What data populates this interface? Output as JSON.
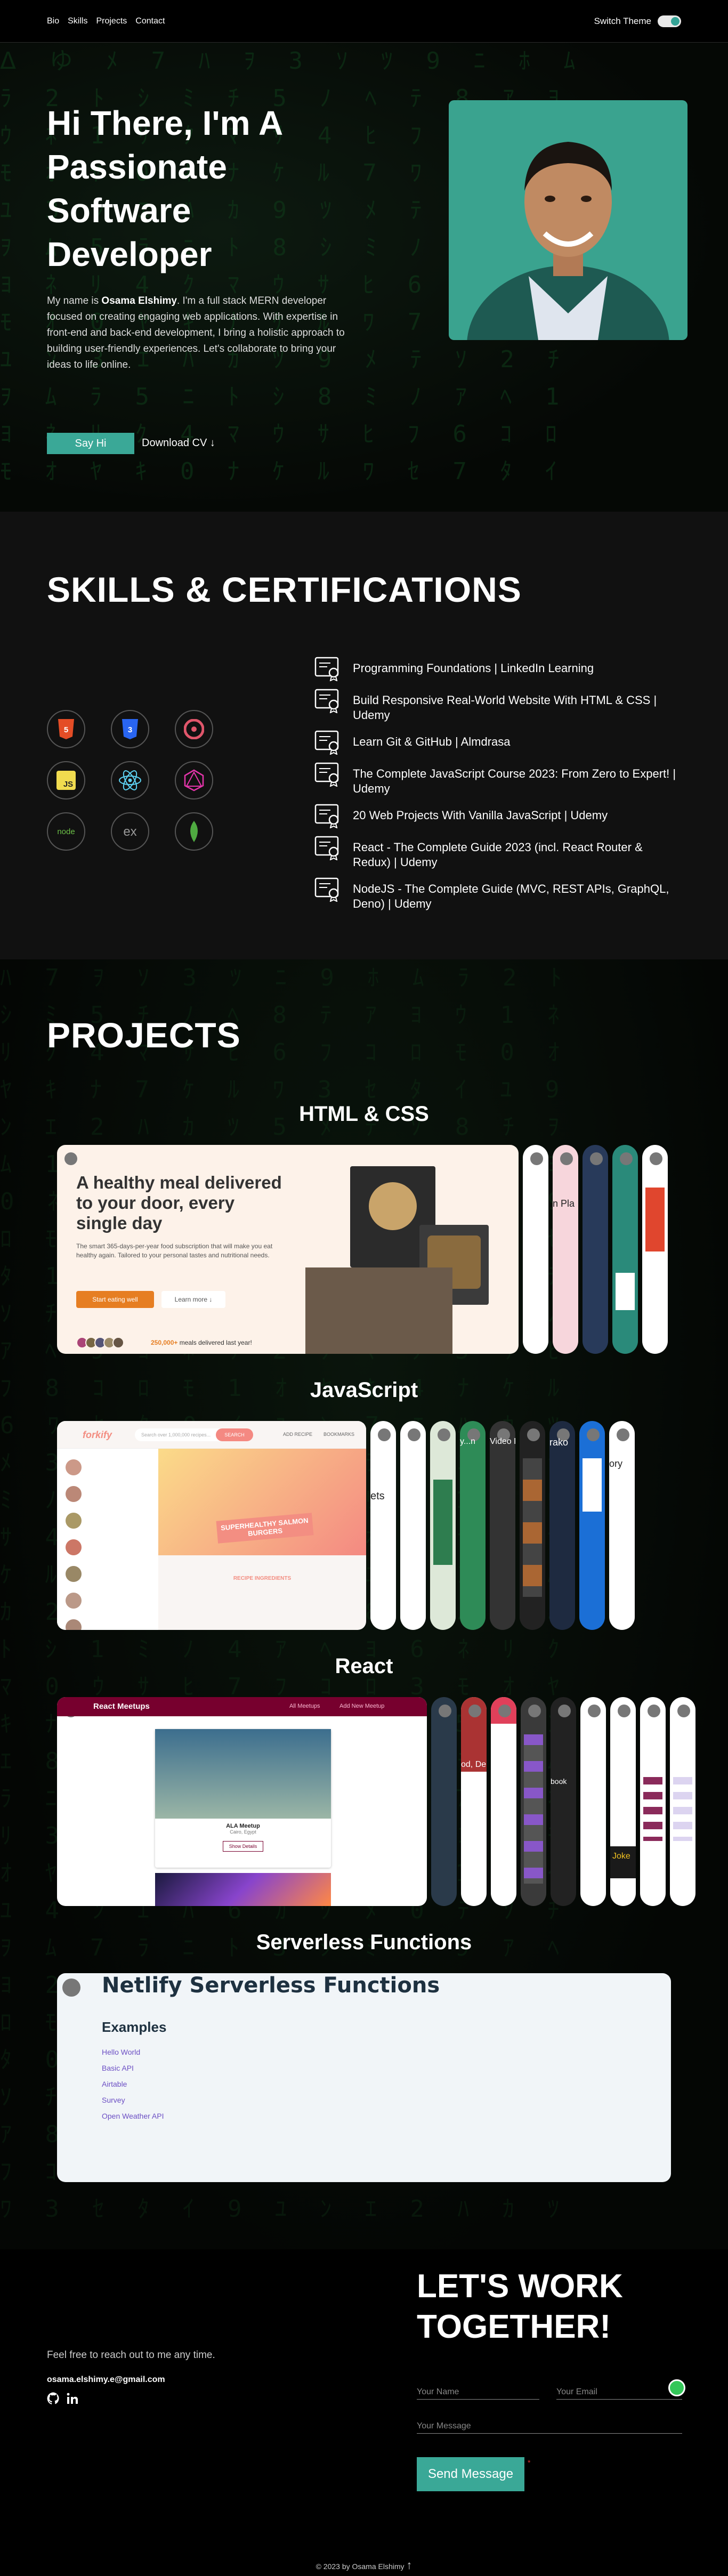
{
  "nav": {
    "links": [
      "Bio",
      "Skills",
      "Projects",
      "Contact"
    ],
    "theme_label": "Switch Theme"
  },
  "hero": {
    "title": "Hi There, I'm A Passionate Software Developer",
    "desc_prefix": "My name is ",
    "desc_name": "Osama Elshimy",
    "desc_rest": ". I'm a full stack MERN developer focused on creating engaging web applications. With expertise in front-end and back-end development, I bring a holistic approach to building user-friendly experiences. Let's collaborate to bring your ideas to life online.",
    "say_hi": "Say Hi",
    "download": "Download CV ↓"
  },
  "skills": {
    "title": "SKILLS & CERTIFICATIONS",
    "icons": [
      "html5-icon",
      "css3-icon",
      "redux-icon",
      "javascript-icon",
      "react-icon",
      "graphql-icon",
      "nodejs-icon",
      "express-icon",
      "mongodb-icon"
    ],
    "certifications": [
      "Programming Foundations | LinkedIn Learning",
      "Build Responsive Real-World Website With HTML & CSS | Udemy",
      "Learn Git & GitHub | Almdrasa",
      "The Complete JavaScript Course 2023: From Zero to Expert! | Udemy",
      "20 Web Projects With Vanilla JavaScript | Udemy",
      "React - The Complete Guide 2023 (incl. React Router & Redux) | Udemy",
      "NodeJS - The Complete Guide (MVC, REST APIs, GraphQL, Deno) | Udemy"
    ]
  },
  "projects": {
    "title": "PROJECTS",
    "groups": [
      "HTML & CSS",
      "JavaScript",
      "React",
      "Serverless Functions"
    ],
    "omnifood": {
      "headline": "A healthy meal delivered to your door, every single day",
      "text": "The smart 365-days-per-year food subscription that will make you eat healthy again. Tailored to your personal tastes and nutritional needs.",
      "cta": "Start eating well",
      "more": "Learn more ↓",
      "stat_num": "250,000+",
      "stat_text": "meals delivered last year!"
    },
    "forkify": {
      "logo": "forkify",
      "search": "Search over 1,000,000 recipes...",
      "search_btn": "SEARCH",
      "add": "ADD RECIPE",
      "bookmarks": "BOOKMARKS",
      "recipe_title": "SUPERHEALTHY SALMON BURGERS",
      "ingredients": "RECIPE INGREDIENTS"
    },
    "meetups": {
      "title": "React Meetups",
      "nav1": "All Meetups",
      "nav2": "Add New Meetup",
      "item_title": "ALA Meetup",
      "item_sub": "Cairo, Egypt",
      "item_btn": "Show Details"
    },
    "netlify": {
      "title": "Netlify Serverless Functions",
      "examples": "Examples",
      "links": [
        "Hello World",
        "Basic API",
        "Airtable",
        "Survey",
        "Open Weather API"
      ]
    },
    "thin_texts": {
      "h2": "n Pla",
      "j1": "ets",
      "j4": "y...n",
      "j5": "Video Fin",
      "j7": "rako",
      "j9": "ory",
      "r3": "od, Del",
      "r7": "book",
      "r9": "Joke"
    }
  },
  "contact": {
    "title": "LET'S WORK TOGETHER!",
    "reach": "Feel free to reach out to me any time.",
    "email": "osama.elshimy.e@gmail.com",
    "name_ph": "Your Name",
    "email_ph": "Your Email",
    "message_ph": "Your Message",
    "send": "Send Message",
    "footer": "© 2023 by Osama Elshimy"
  },
  "colors": {
    "accent": "#3aa897",
    "background": "#0b0b0b"
  }
}
